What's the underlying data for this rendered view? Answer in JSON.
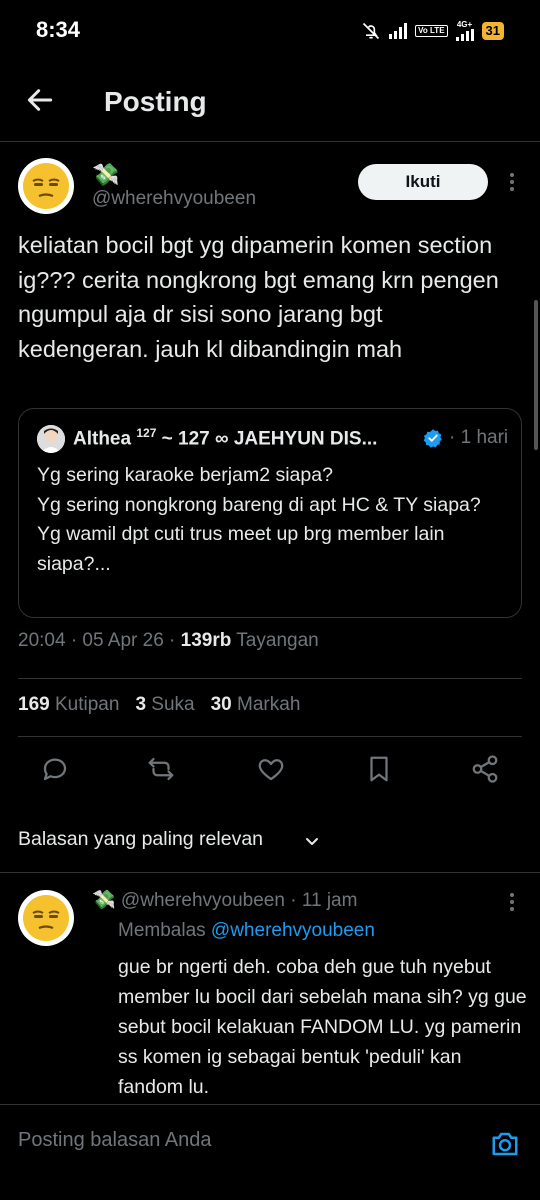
{
  "status_bar": {
    "time": "8:34",
    "network_label": "4G+",
    "volte_label": "Vo LTE",
    "battery": "31"
  },
  "header": {
    "title": "Posting"
  },
  "post": {
    "emoji_name": "💸",
    "handle": "@wherehvyoubeen",
    "follow_label": "Ikuti",
    "text": "keliatan bocil bgt yg dipamerin komen section ig??? cerita nongkrong bgt emang krn pengen ngumpul aja dr sisi sono jarang bgt kedengeran. jauh kl dibandingin mah",
    "quote": {
      "name": "Althea",
      "name_sup": "127",
      "name_rest": " ~ 127 ∞ JAEHYUN DIS...",
      "time": "· 1 hari",
      "text_lines": [
        "Yg sering karaoke berjam2 siapa?",
        "Yg sering nongkrong bareng di apt HC & TY siapa?",
        "Yg wamil dpt cuti trus meet up brg member lain siapa?..."
      ]
    },
    "meta": {
      "time": "20:04 · 05 Apr 26 · ",
      "views_count": "139rb",
      "views_label": " Tayangan"
    },
    "stats": {
      "quotes_count": "169",
      "quotes_label": " Kutipan",
      "likes_count": "3",
      "likes_label": " Suka",
      "bookmarks_count": "30",
      "bookmarks_label": " Markah"
    }
  },
  "sort": {
    "label": "Balasan yang paling relevan"
  },
  "reply": {
    "header": "💸 @wherehvyoubeen · 11 jam",
    "replying_prefix": "Membalas ",
    "replying_mention": "@wherehvyoubeen",
    "text": "gue br ngerti deh. coba deh gue tuh nyebut member lu bocil dari sebelah mana sih? yg gue sebut bocil kelakuan FANDOM LU. yg pamerin ss komen ig sebagai bentuk 'peduli' kan fandom lu."
  },
  "compose": {
    "placeholder": "Posting balasan Anda"
  },
  "colors": {
    "background": "#000000",
    "text": "#e7e9ea",
    "muted": "#71767b",
    "accent": "#1d9bf0",
    "border": "#2f3336",
    "battery": "#f3b530"
  },
  "icons": [
    "back-arrow-icon",
    "more-icon",
    "verified-icon",
    "reply-icon",
    "repost-icon",
    "like-icon",
    "bookmark-icon",
    "share-icon",
    "chevron-down-icon",
    "camera-icon",
    "mute-icon",
    "signal-icon"
  ]
}
